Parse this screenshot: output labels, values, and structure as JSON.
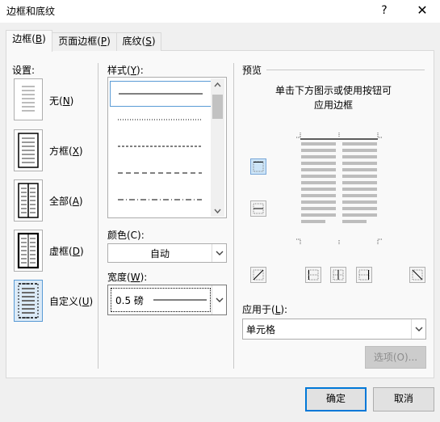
{
  "window": {
    "title": "边框和底纹",
    "help": "?",
    "close": "✕"
  },
  "tabs": [
    {
      "label": "边框(",
      "key": "B",
      "tail": ")"
    },
    {
      "label": "页面边框(",
      "key": "P",
      "tail": ")"
    },
    {
      "label": "底纹(",
      "key": "S",
      "tail": ")"
    }
  ],
  "settings": {
    "heading": "设置:",
    "items": [
      {
        "label": "无(",
        "key": "N",
        "tail": ")"
      },
      {
        "label": "方框(",
        "key": "X",
        "tail": ")"
      },
      {
        "label": "全部(",
        "key": "A",
        "tail": ")"
      },
      {
        "label": "虚框(",
        "key": "D",
        "tail": ")"
      },
      {
        "label": "自定义(",
        "key": "U",
        "tail": ")"
      }
    ]
  },
  "style": {
    "heading": "样式(",
    "key": "Y",
    "tail": "):",
    "items": [
      "solid",
      "dotted",
      "dashed-small",
      "dashed",
      "dash-dot"
    ]
  },
  "color": {
    "heading": "颜色(C):",
    "value": "自动"
  },
  "width": {
    "heading": "宽度(",
    "key": "W",
    "tail": "):",
    "value": "0.5 磅"
  },
  "preview": {
    "heading": "预览",
    "hint_line1": "单击下方图示或使用按钮可",
    "hint_line2": "应用边框"
  },
  "apply_to": {
    "heading": "应用于(",
    "key": "L",
    "tail": "):",
    "value": "单元格"
  },
  "buttons": {
    "options": "选项(O)...",
    "ok": "确定",
    "cancel": "取消"
  }
}
